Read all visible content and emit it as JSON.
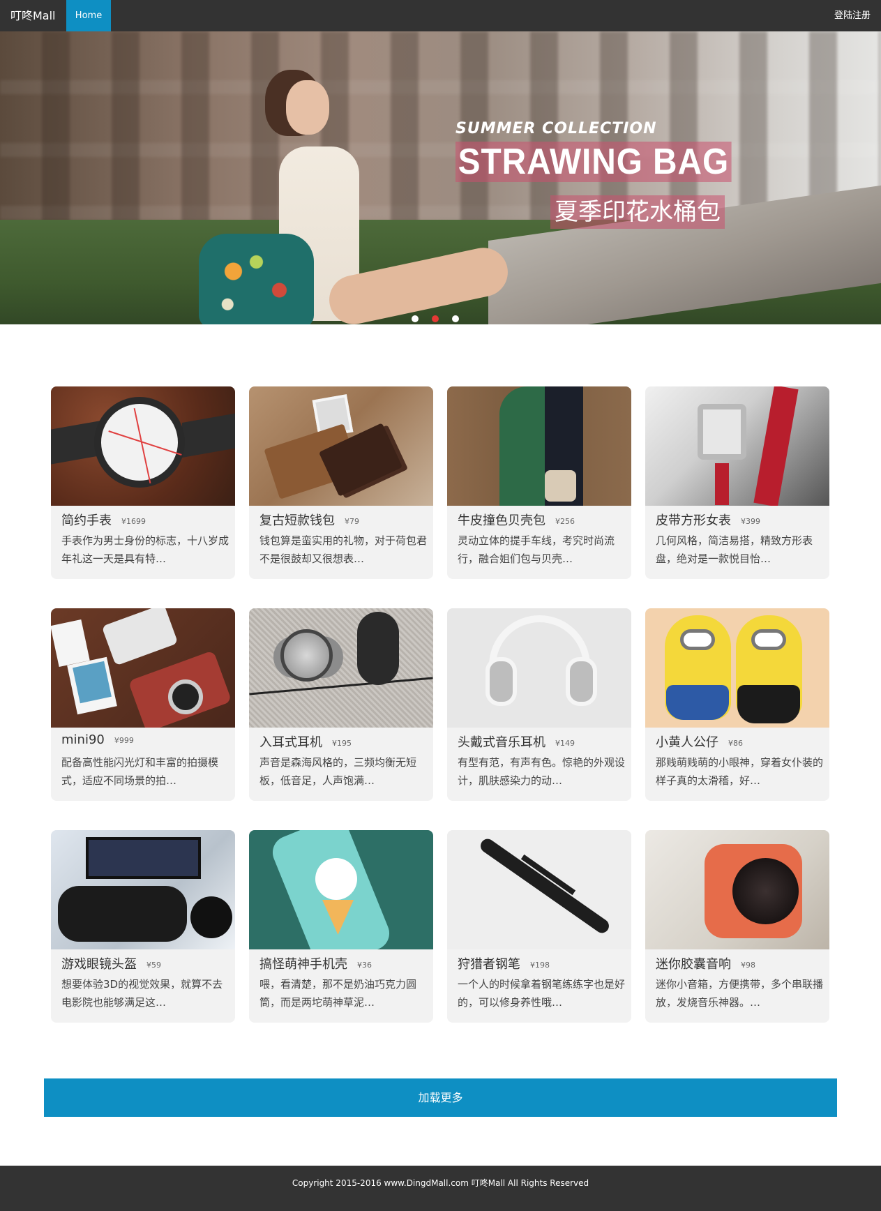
{
  "navbar": {
    "brand": "叮咚Mall",
    "home": "Home",
    "login": "登陆注册"
  },
  "hero": {
    "kicker": "SUMMER COLLECTION",
    "headline": "STRAWING BAG",
    "subline": "夏季印花水桶包",
    "dots": [
      {
        "active": false
      },
      {
        "active": true
      },
      {
        "active": false
      }
    ]
  },
  "products": [
    {
      "name": "简约手表",
      "price": "¥1699",
      "desc": "手表作为男士身份的标志，十八岁成年礼这一天是具有特…",
      "image": "watch-image"
    },
    {
      "name": "复古短款钱包",
      "price": "¥79",
      "desc": "钱包算是蛮实用的礼物，对于荷包君不是很鼓却又很想表…",
      "image": "wallet-image"
    },
    {
      "name": "牛皮撞色贝壳包",
      "price": "¥256",
      "desc": "灵动立体的提手车线，考究时尚流行，融合姐们包与贝壳…",
      "image": "bag-image"
    },
    {
      "name": "皮带方形女表",
      "price": "¥399",
      "desc": "几何风格，简洁易搭，精致方形表盘，绝对是一款悦目怡…",
      "image": "ladies-watch-image"
    },
    {
      "name": "mini90",
      "price": "¥999",
      "desc": "配备高性能闪光灯和丰富的拍摄模式，适应不同场景的拍…",
      "image": "camera-image"
    },
    {
      "name": "入耳式耳机",
      "price": "¥195",
      "desc": "声音是森海风格的，三频均衡无短板，低音足，人声饱满…",
      "image": "earphone-image"
    },
    {
      "name": "头戴式音乐耳机",
      "price": "¥149",
      "desc": "有型有范，有声有色。惊艳的外观设计，肌肤感染力的动…",
      "image": "headphone-image"
    },
    {
      "name": "小黄人公仔",
      "price": "¥86",
      "desc": "那贱萌贱萌的小眼神，穿着女仆装的样子真的太滑稽，好…",
      "image": "minion-image"
    },
    {
      "name": "游戏眼镜头盔",
      "price": "¥59",
      "desc": "想要体验3D的视觉效果，就算不去电影院也能够满足这…",
      "image": "vr-image"
    },
    {
      "name": "搞怪萌神手机壳",
      "price": "¥36",
      "desc": "喂，看清楚，那不是奶油巧克力圆筒，而是两坨萌神草泥…",
      "image": "phone-case-image"
    },
    {
      "name": "狩猎者钢笔",
      "price": "¥198",
      "desc": "一个人的时候拿着钢笔练练字也是好的，可以修身养性哦…",
      "image": "pen-image"
    },
    {
      "name": "迷你胶囊音响",
      "price": "¥98",
      "desc": "迷你小音箱，方便携带，多个串联播放，发烧音乐神器。…",
      "image": "speaker-image"
    }
  ],
  "load_more": "加载更多",
  "footer": "Copyright 2015-2016 www.DingdMall.com 叮咚Mall All Rights Reserved",
  "colors": {
    "navbar": "#333333",
    "accent": "#0e8fc3",
    "card_bg": "#f2f2f2"
  }
}
